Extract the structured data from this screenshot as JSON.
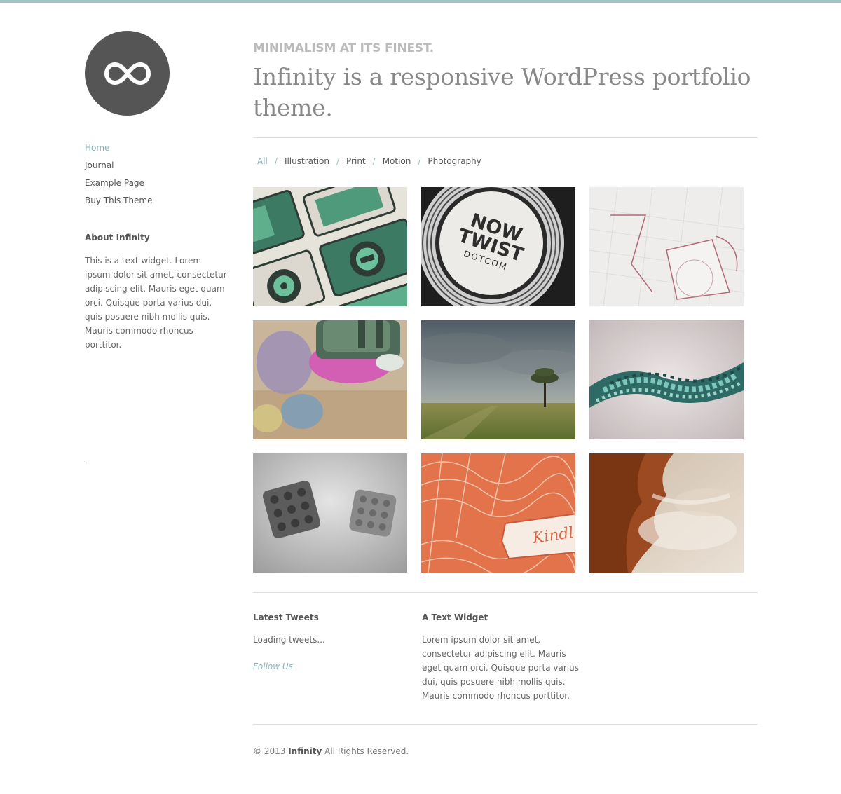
{
  "site": {
    "name": "Infinity",
    "tagline": "MINIMALISM AT ITS FINEST.",
    "headline": "Infinity is a responsive WordPress portfolio theme."
  },
  "logo": {
    "icon": "infinity-icon"
  },
  "nav": {
    "items": [
      {
        "label": "Home",
        "active": true
      },
      {
        "label": "Journal"
      },
      {
        "label": "Example Page"
      },
      {
        "label": "Buy This Theme"
      }
    ]
  },
  "about": {
    "title": "About Infinity",
    "text": "This is a text widget. Lorem ipsum dolor sit amet, consectetur adipiscing elit. Mauris eget quam orci. Quisque porta varius dui, quis posuere nibh mollis quis. Mauris commodo rhoncus porttitor."
  },
  "filters": {
    "separator": "/",
    "items": [
      "All",
      "Illustration",
      "Print",
      "Motion",
      "Photography"
    ]
  },
  "portfolio": {
    "items": [
      {
        "name": "retro-radio-illustration"
      },
      {
        "name": "now-twist-coaster",
        "text_lines": [
          "NOW",
          "TWIST",
          "DOTCOM"
        ]
      },
      {
        "name": "letterpress-grid-print"
      },
      {
        "name": "blurred-toy-motion"
      },
      {
        "name": "lone-tree-field-photo"
      },
      {
        "name": "twisted-mosaic-render"
      },
      {
        "name": "lego-dice-render"
      },
      {
        "name": "orange-engraving-print",
        "text": "Kindl"
      },
      {
        "name": "smoke-rock-photo"
      }
    ]
  },
  "tweets": {
    "title": "Latest Tweets",
    "status": "Loading tweets...",
    "follow": "Follow Us"
  },
  "text_widget": {
    "title": "A Text Widget",
    "text": "Lorem ipsum dolor sit amet, consectetur adipiscing elit. Mauris eget quam orci. Quisque porta varius dui, quis posuere nibh mollis quis. Mauris commodo rhoncus porttitor."
  },
  "footer": {
    "copyright": "© 2013",
    "brand": "Infinity",
    "rights": "All Rights Reserved."
  },
  "colors": {
    "accent": "#8ab2b6",
    "top_bar": "#9fc3c6",
    "logo_bg": "#555555"
  }
}
